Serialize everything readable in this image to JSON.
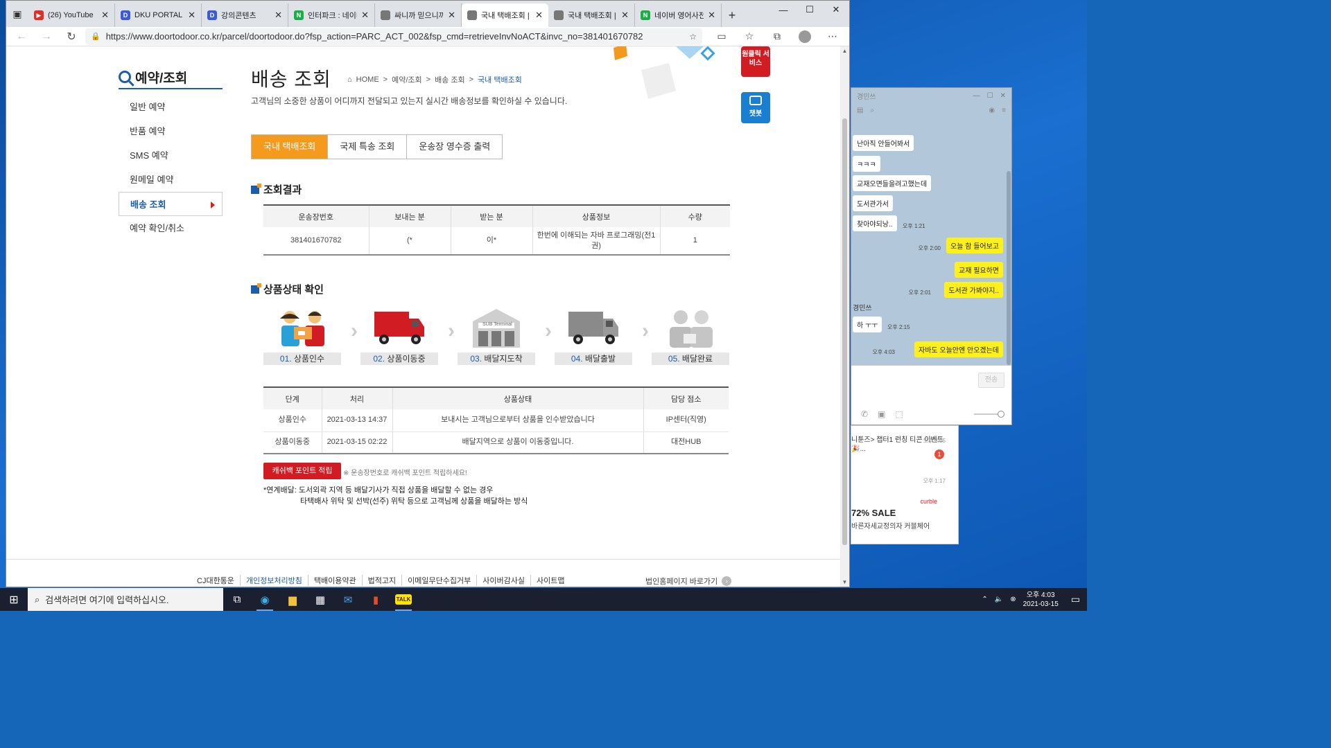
{
  "browser": {
    "tabs": [
      {
        "title": "(26) YouTube",
        "color": "#e52d27",
        "glyph": "▶"
      },
      {
        "title": "DKU PORTAL",
        "color": "#3b5bdb",
        "glyph": "D"
      },
      {
        "title": "강의콘텐츠",
        "color": "#3b5bdb",
        "glyph": "D"
      },
      {
        "title": "인터파크 : 네이바",
        "color": "#1aae48",
        "glyph": "N"
      },
      {
        "title": "싸니까 믿으니까",
        "color": "#777777",
        "glyph": ""
      },
      {
        "title": "국내 택배조회 | 배",
        "color": "#777777",
        "glyph": ""
      },
      {
        "title": "국내 택배조회 | 배",
        "color": "#777777",
        "glyph": ""
      },
      {
        "title": "네이버 영어사전",
        "color": "#1aae48",
        "glyph": "N"
      }
    ],
    "url": "https://www.doortodoor.co.kr/parcel/doortodoor.do?fsp_action=PARC_ACT_002&fsp_cmd=retrieveInvNoACT&invc_no=381401670782"
  },
  "sidebar": {
    "title": "예약/조회",
    "items": [
      "일반 예약",
      "반품 예약",
      "SMS 예약",
      "원메일 예약",
      "배송 조회",
      "예약 확인/취소"
    ]
  },
  "page": {
    "title": "배송 조회",
    "breadcrumb": [
      "HOME",
      ">",
      "예약/조회",
      ">",
      "배송 조회",
      ">",
      "국내 택배조회"
    ],
    "desc": "고객님의 소중한 상품이 어디까지 전달되고 있는지 실시간 배송정보를 확인하실 수 있습니다.",
    "side_btn1": "원클릭 서비스",
    "side_btn2": "챗봇"
  },
  "tabs": [
    "국내 택배조회",
    "국제 특송 조회",
    "운송장 영수증 출력"
  ],
  "result": {
    "heading": "조회결과",
    "headers": [
      "운송장번호",
      "보내는 분",
      "받는 분",
      "상품정보",
      "수량"
    ],
    "row": [
      "381401670782",
      "(*",
      "이*",
      "한번에 이해되는 자바 프로그래밍(전1권)",
      "1"
    ]
  },
  "status": {
    "heading": "상품상태 확인",
    "steps": [
      {
        "num": "01.",
        "label": "상품인수"
      },
      {
        "num": "02.",
        "label": "상품이동중"
      },
      {
        "num": "03.",
        "label": "배달지도착"
      },
      {
        "num": "04.",
        "label": "배달출발"
      },
      {
        "num": "05.",
        "label": "배달완료"
      }
    ],
    "terminal": "SUB Terminal"
  },
  "history": {
    "headers": [
      "단계",
      "처리",
      "상품상태",
      "담당 점소"
    ],
    "rows": [
      [
        "상품인수",
        "2021-03-13 14:37",
        "보내시는 고객님으로부터 상품을 인수받았습니다",
        "IP센터(직영)"
      ],
      [
        "상품이동중",
        "2021-03-15 02:22",
        "배달지역으로 상품이 이동중입니다.",
        "대전HUB"
      ]
    ]
  },
  "cashback": {
    "button": "캐쉬백 포인트 적립",
    "note": "※ 운송장번호로 캐쉬백 포인트 적립하세요!"
  },
  "notes": {
    "line1": "*연계배달: 도서외곽 지역 등 배달기사가 직접 상품을 배달할 수 없는 경우",
    "line2": "타택배사 위탁 및 선박(선주) 위탁 등으로 고객님께 상품을 배달하는 방식"
  },
  "footer": {
    "links": [
      "CJ대한통운",
      "개인정보처리방침",
      "택배이용약관",
      "법적고지",
      "이메일무단수집거부",
      "사이버감사실",
      "사이트맵"
    ],
    "right": "법인홈페이지 바로가기"
  },
  "chat": {
    "name": "경민쓰",
    "messages": [
      {
        "text": "난아직 안들어봐서",
        "me": false
      },
      {
        "text": "ㅋㅋㅋ",
        "me": false
      },
      {
        "text": "교재오면들을려고했는데",
        "me": false
      },
      {
        "text": "도서관가서",
        "me": false
      },
      {
        "text": "찾아야되낭..",
        "me": false,
        "time": "오후 1:21"
      },
      {
        "text": "오늘 함 들어보고",
        "me": true,
        "time": "오후 2:00"
      },
      {
        "text": "교재 필요하면",
        "me": true
      },
      {
        "text": "도서관 가봐야지..",
        "me": true,
        "time": "오후 2:01"
      },
      {
        "text": "하 ㅜㅜ",
        "me": false,
        "time": "오후 2:15"
      },
      {
        "text": "자바도 오늘안엔 안오겠는데",
        "me": true,
        "time": "오후 4:03"
      }
    ],
    "sender": "경민쓰",
    "send_label": "전송"
  },
  "kakao_list": {
    "item1": "니툰즈> 챕터1 런칭 티콘 이벤트🎉...",
    "item1_time": "오후 2:05",
    "item1_badge": "1",
    "item2_time": "오후 1:17",
    "ad_brand": "curble",
    "ad_sale": "72% SALE",
    "ad_text": "바른자세교정의자 커블체어"
  },
  "taskbar": {
    "search_placeholder": "검색하려면 여기에 입력하십시오.",
    "time": "오후 4:03",
    "date": "2021-03-15"
  }
}
